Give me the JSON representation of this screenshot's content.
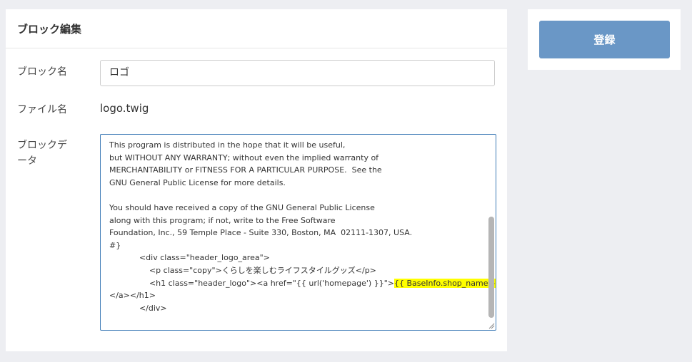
{
  "card": {
    "title": "ブロック編集"
  },
  "form": {
    "block_name_label": "ブロック名",
    "block_name_value": "ロゴ",
    "file_name_label": "ファイル名",
    "file_name_value": "logo.twig",
    "block_data_label_1": "ブロックデ",
    "block_data_label_2": "ータ",
    "code_lines": [
      "This program is distributed in the hope that it will be useful,",
      "but WITHOUT ANY WARRANTY; without even the implied warranty of",
      "MERCHANTABILITY or FITNESS FOR A PARTICULAR PURPOSE.  See the",
      "GNU General Public License for more details.",
      "",
      "You should have received a copy of the GNU General Public License",
      "along with this program; if not, write to the Free Software",
      "Foundation, Inc., 59 Temple Place - Suite 330, Boston, MA  02111-1307, USA.",
      "#}",
      "            <div class=\"header_logo_area\">",
      "                <p class=\"copy\">くらしを楽しむライフスタイルグッズ</p>",
      "                <h1 class=\"header_logo\"><a href=\"{{ url('homepage') }}\">",
      "</a></h1>",
      "            </div>"
    ],
    "code_highlight": "{{ BaseInfo.shop_name }}"
  },
  "sidebar": {
    "submit_label": "登録"
  },
  "colors": {
    "accent": "#6a97c6",
    "focus_border": "#3e7bb6",
    "highlight": "#ffff00",
    "background": "#edeef2"
  }
}
